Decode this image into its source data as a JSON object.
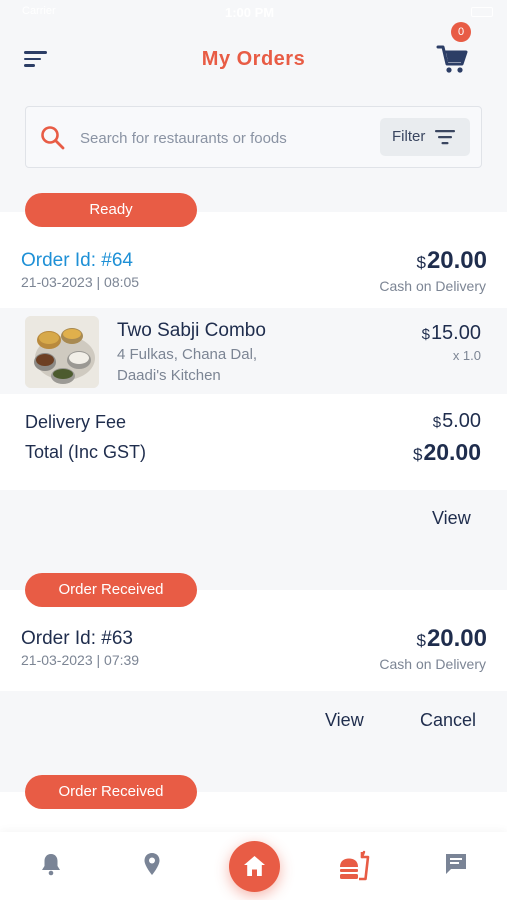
{
  "status_bar": {
    "carrier": "Carrier",
    "time": "1:00 PM"
  },
  "header": {
    "title": "My Orders",
    "cart_count": "0"
  },
  "search": {
    "placeholder": "Search for restaurants or foods",
    "filter_label": "Filter"
  },
  "orders": [
    {
      "status": "Ready",
      "order_id": "Order Id: #64",
      "datetime": "21-03-2023 | 08:05",
      "currency": "$",
      "total": "20.00",
      "payment": "Cash on Delivery",
      "item": {
        "name": "Two Sabji Combo",
        "desc_line1": "4 Fulkas, Chana Dal,",
        "desc_line2": "Daadi's Kitchen",
        "price": "15.00",
        "qty": "x 1.0"
      },
      "delivery_fee_label": "Delivery Fee",
      "delivery_fee": "5.00",
      "total_label": "Total (Inc GST)",
      "grand_total": "20.00",
      "actions": {
        "view": "View"
      }
    },
    {
      "status": "Order Received",
      "order_id": "Order Id: #63",
      "datetime": "21-03-2023 | 07:39",
      "currency": "$",
      "total": "20.00",
      "payment": "Cash on Delivery",
      "actions": {
        "view": "View",
        "cancel": "Cancel"
      }
    },
    {
      "status": "Order Received"
    }
  ],
  "tabs": [
    "notifications-icon",
    "location-icon",
    "home-icon",
    "orders-icon",
    "chat-icon"
  ],
  "colors": {
    "accent": "#e85c45",
    "link": "#1e90d6",
    "text": "#1f2d4d",
    "muted": "#7c8594"
  }
}
